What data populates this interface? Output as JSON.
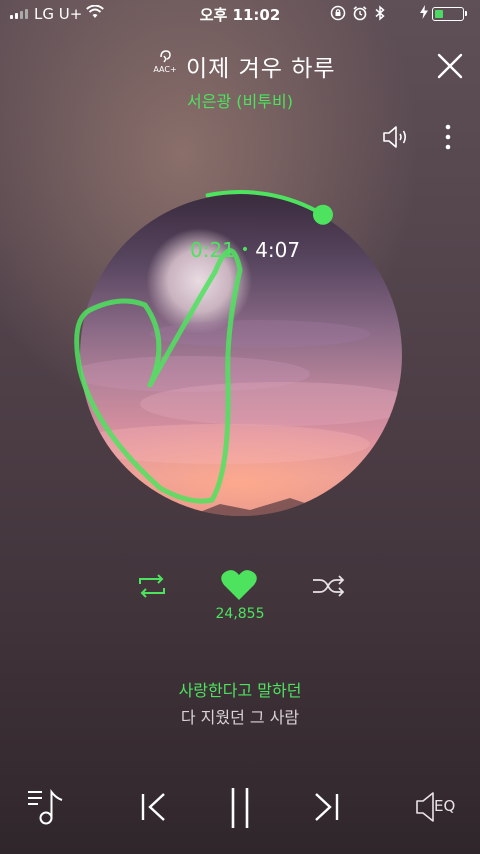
{
  "status_bar": {
    "carrier": "LG U+",
    "time": "오후 11:02"
  },
  "header": {
    "aac_label": "AAC+",
    "title": "이제 겨우 하루",
    "artist": "서은광 (비투비)"
  },
  "player": {
    "current_time": "0:21",
    "total_time": "4:07",
    "progress": 0.085,
    "like_count": "24,855",
    "liked": true
  },
  "lyrics": {
    "current_line": "사랑한다고 말하던",
    "next_line": "다 지웠던 그 사람"
  },
  "controls": {
    "eq_label": "EQ"
  },
  "colors": {
    "accent": "#4de35e",
    "battery": "#4cd964"
  }
}
